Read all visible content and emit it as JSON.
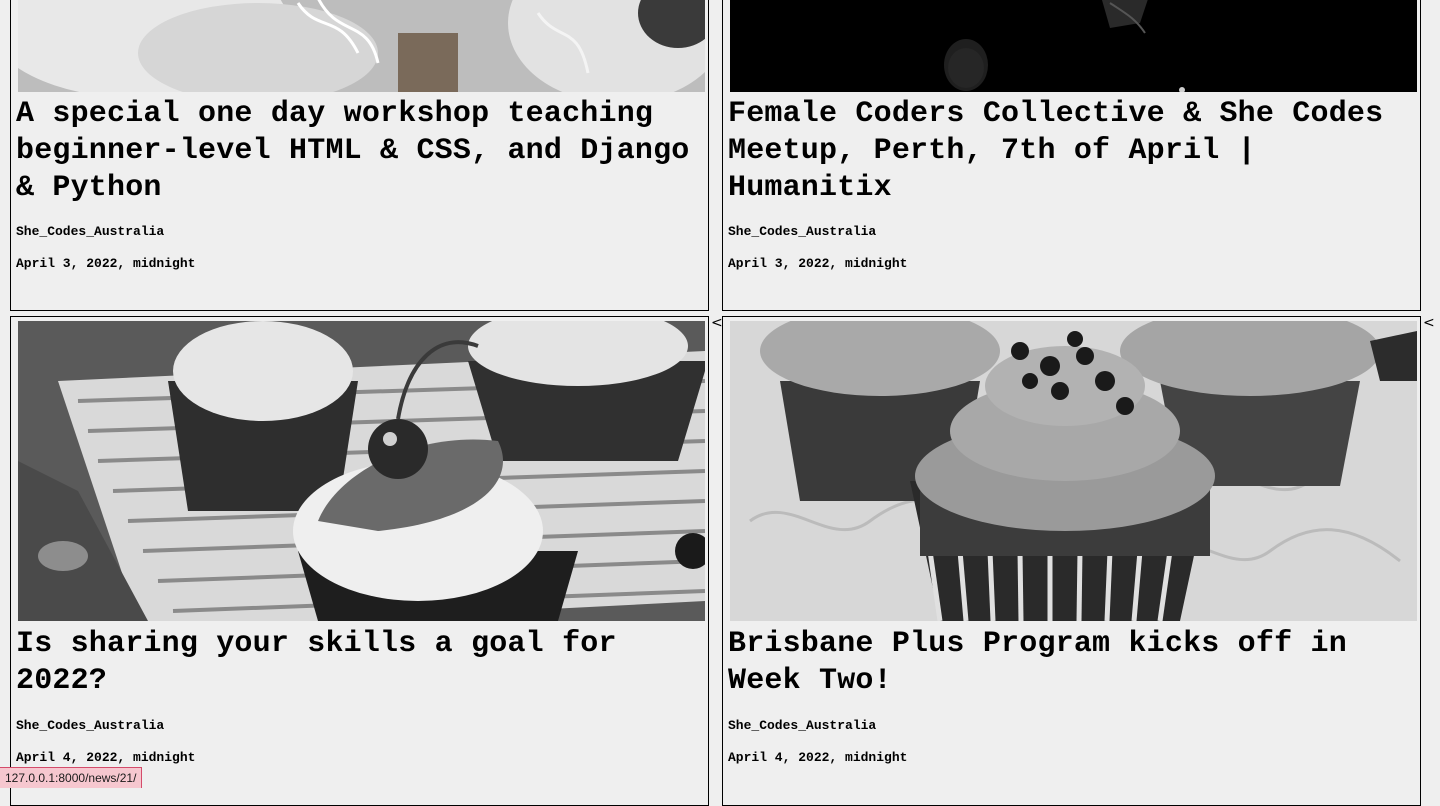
{
  "articles": [
    {
      "title": "A special one day workshop teaching beginner-level HTML & CSS, and Django & Python",
      "author": "She_Codes_Australia",
      "date": "April 3, 2022, midnight",
      "image": "cupcake-photo"
    },
    {
      "title": "Female Coders Collective & She Codes Meetup, Perth, 7th of April | Humanitix",
      "author": "She_Codes_Australia",
      "date": "April 3, 2022, midnight",
      "image": "dark-photo"
    },
    {
      "title": "Is sharing your skills a goal for 2022?",
      "author": "She_Codes_Australia",
      "date": "April 4, 2022, midnight",
      "image": "cherry-cupcake-photo"
    },
    {
      "title": "Brisbane Plus Program kicks off in Week Two!",
      "author": "She_Codes_Australia",
      "date": "April 4, 2022, midnight",
      "image": "chocolate-chip-cupcake-photo"
    }
  ],
  "chevrons": [
    "<",
    "<"
  ],
  "status_bar": {
    "url": "127.0.0.1:8000/news/21/"
  },
  "colors": {
    "background": "#efefef",
    "status_bar_bg": "#f6c7cf",
    "status_bar_border": "#d44b6a"
  }
}
